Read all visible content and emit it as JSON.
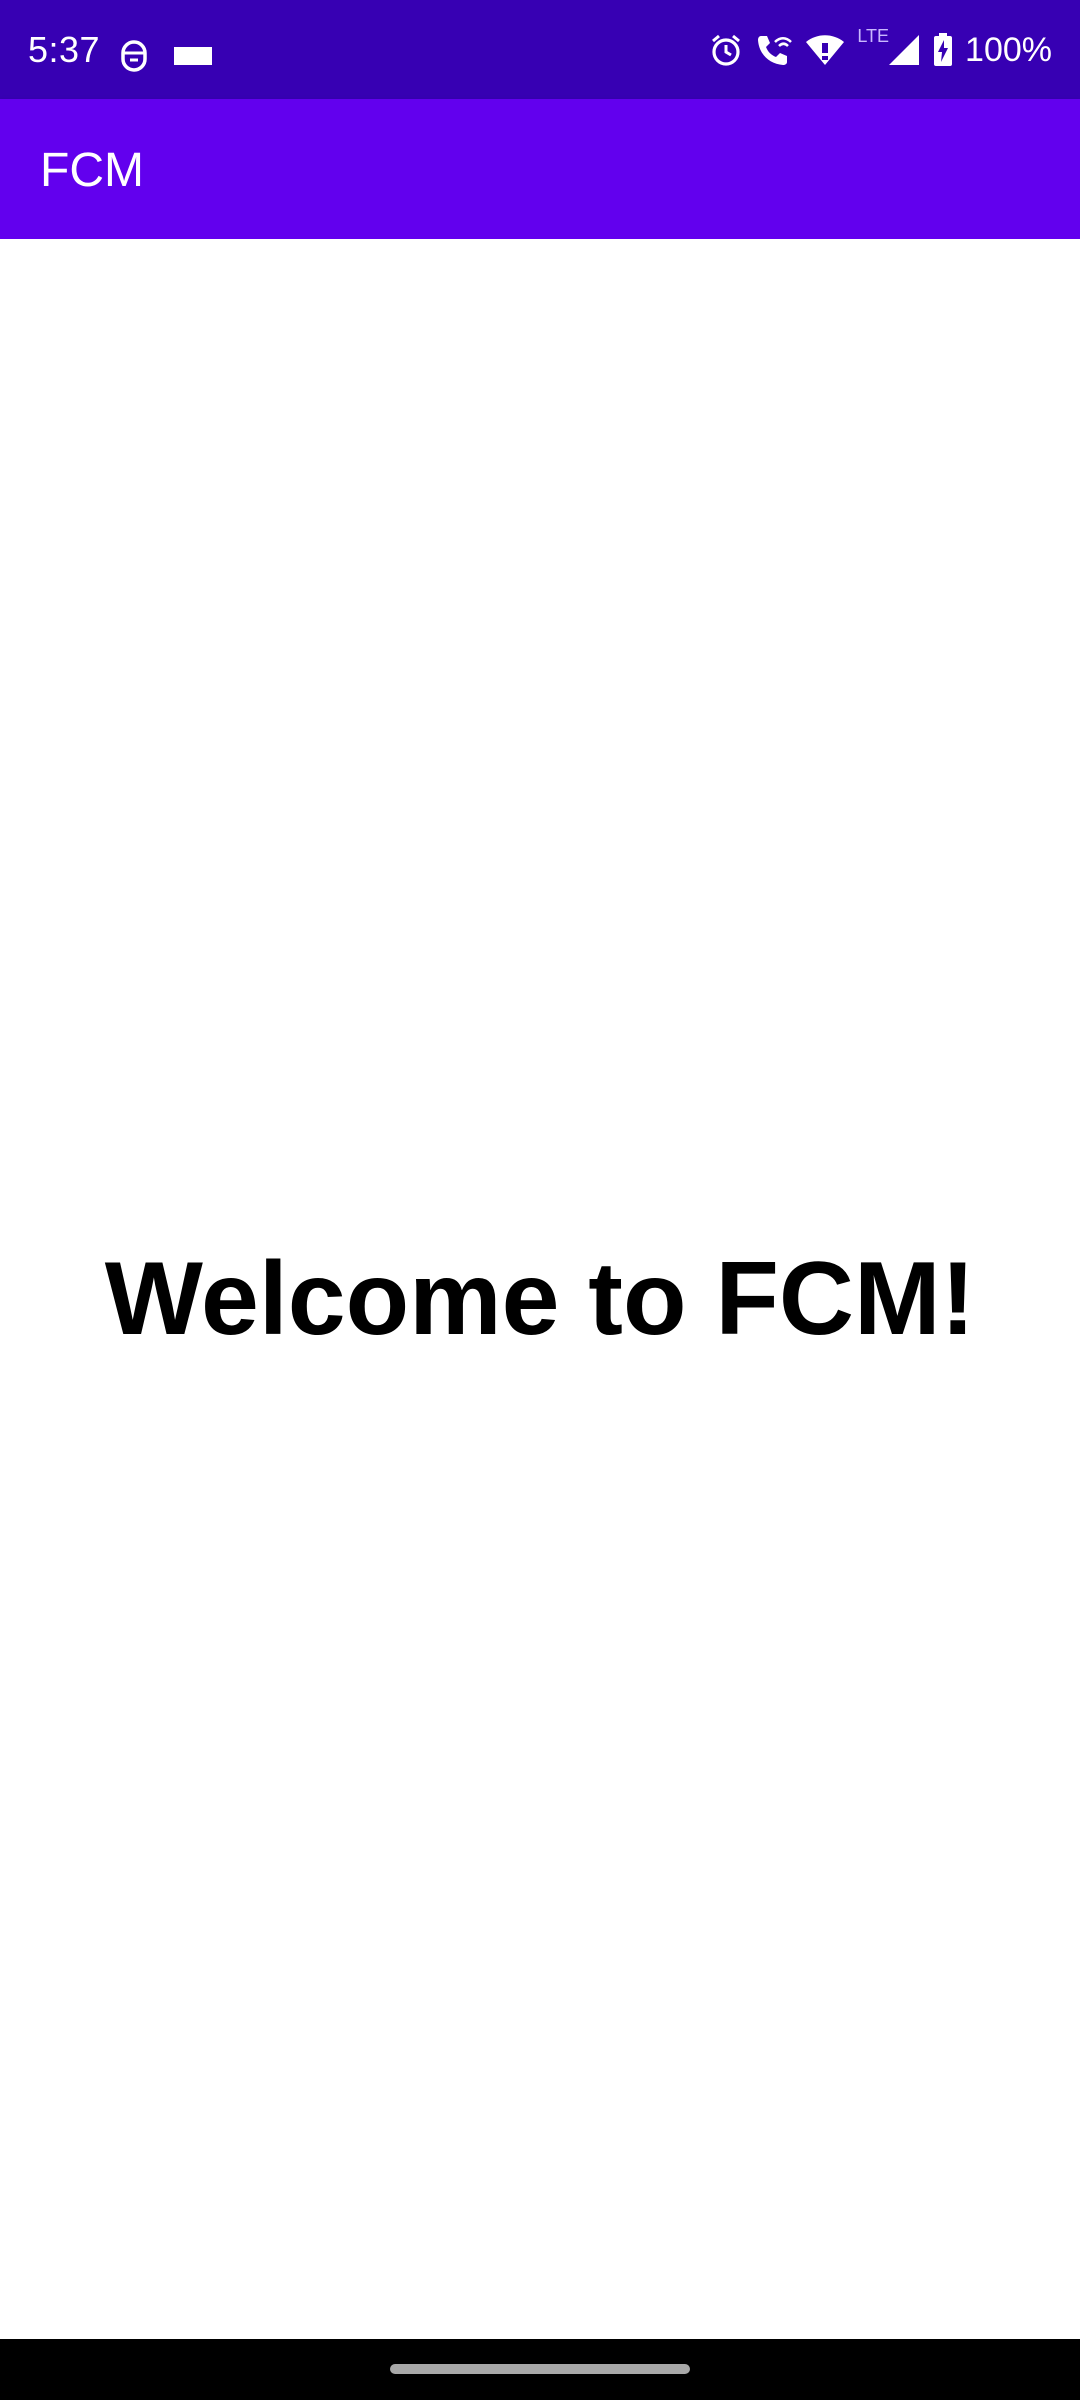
{
  "status_bar": {
    "time": "5:37",
    "battery_text": "100%",
    "network_label": "LTE",
    "left_icons": [
      "assistant-icon",
      "notification-bar-icon"
    ],
    "right_icons": [
      "alarm-icon",
      "wifi-calling-icon",
      "wifi-icon",
      "cell-signal-icon",
      "battery-charging-icon"
    ],
    "background_color": "#3700b3"
  },
  "app_bar": {
    "title": "FCM",
    "background_color": "#6200ee"
  },
  "main": {
    "welcome_text": "Welcome to FCM!"
  },
  "nav_bar": {
    "background_color": "#000000"
  }
}
